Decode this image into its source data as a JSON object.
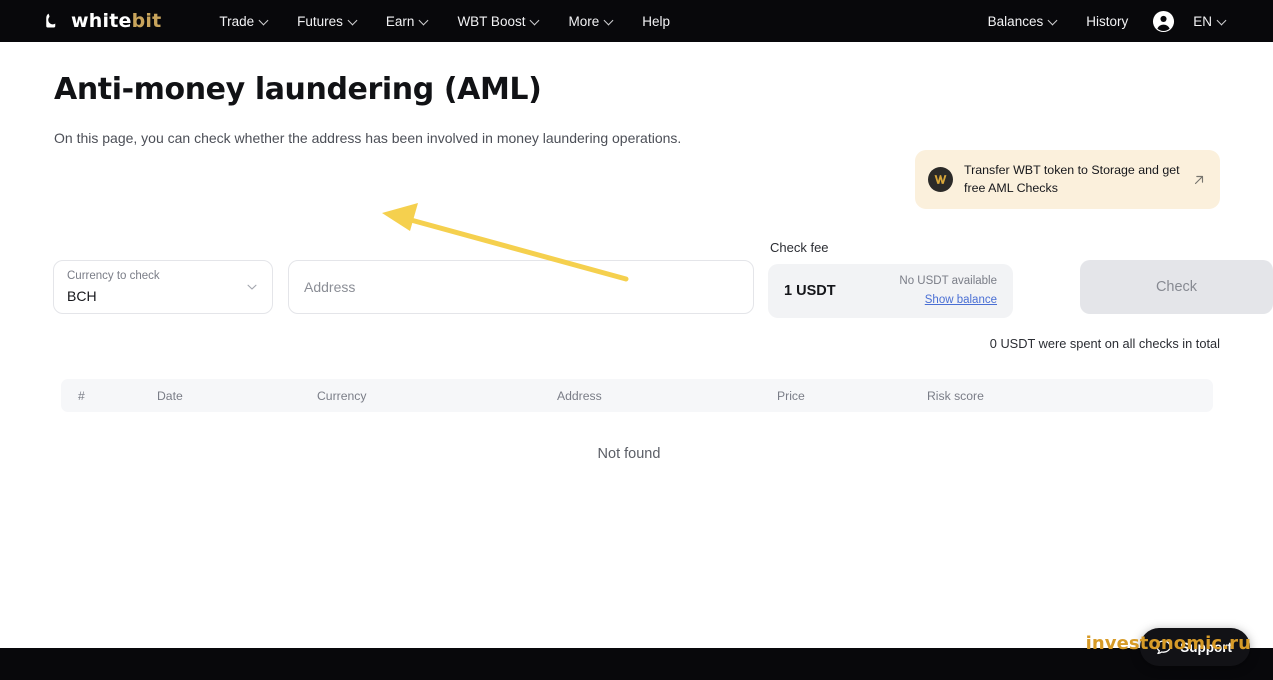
{
  "nav": {
    "logo": {
      "icon": "whitebit-rabbit-logo",
      "text_white": "white",
      "text_gold": "bit"
    },
    "items": [
      {
        "label": "Trade",
        "has_caret": true
      },
      {
        "label": "Futures",
        "has_caret": true
      },
      {
        "label": "Earn",
        "has_caret": true
      },
      {
        "label": "WBT Boost",
        "has_caret": true
      },
      {
        "label": "More",
        "has_caret": true
      },
      {
        "label": "Help",
        "has_caret": false
      }
    ],
    "right": {
      "balances": "Balances",
      "history": "History",
      "account_icon": "account-circle-icon",
      "language": "EN"
    }
  },
  "page": {
    "title": "Anti-money laundering (AML)",
    "subtitle": "On this page, you can check whether the address has been involved in money laundering operations."
  },
  "promo": {
    "icon": "wbt-token-icon",
    "text": "Transfer WBT token to Storage and get free AML Checks",
    "arrow_icon": "external-link-arrow-icon"
  },
  "form": {
    "currency": {
      "label": "Currency to check",
      "value": "BCH",
      "chevron_icon": "chevron-down-icon"
    },
    "address": {
      "placeholder": "Address",
      "value": ""
    },
    "fee": {
      "caption": "Check fee",
      "amount": "1 USDT",
      "note": "No USDT available",
      "link": "Show balance"
    },
    "check_button": "Check",
    "total_note": "0 USDT were spent on all checks in total"
  },
  "table": {
    "columns": [
      "#",
      "Date",
      "Currency",
      "Address",
      "Price",
      "Risk score"
    ],
    "rows": [],
    "empty_message": "Not found"
  },
  "support": {
    "label": "Support",
    "icon": "chat-bubble-icon"
  },
  "watermark": "investonomic.ru",
  "colors": {
    "nav_bg": "#08080b",
    "accent_gold": "#c8a45c",
    "promo_bg": "#fbf0dc",
    "disabled_btn": "#e4e5e9",
    "link_blue": "#4a6fd4",
    "annotation_arrow": "#f5d04e",
    "watermark_gold": "#d79b28"
  }
}
